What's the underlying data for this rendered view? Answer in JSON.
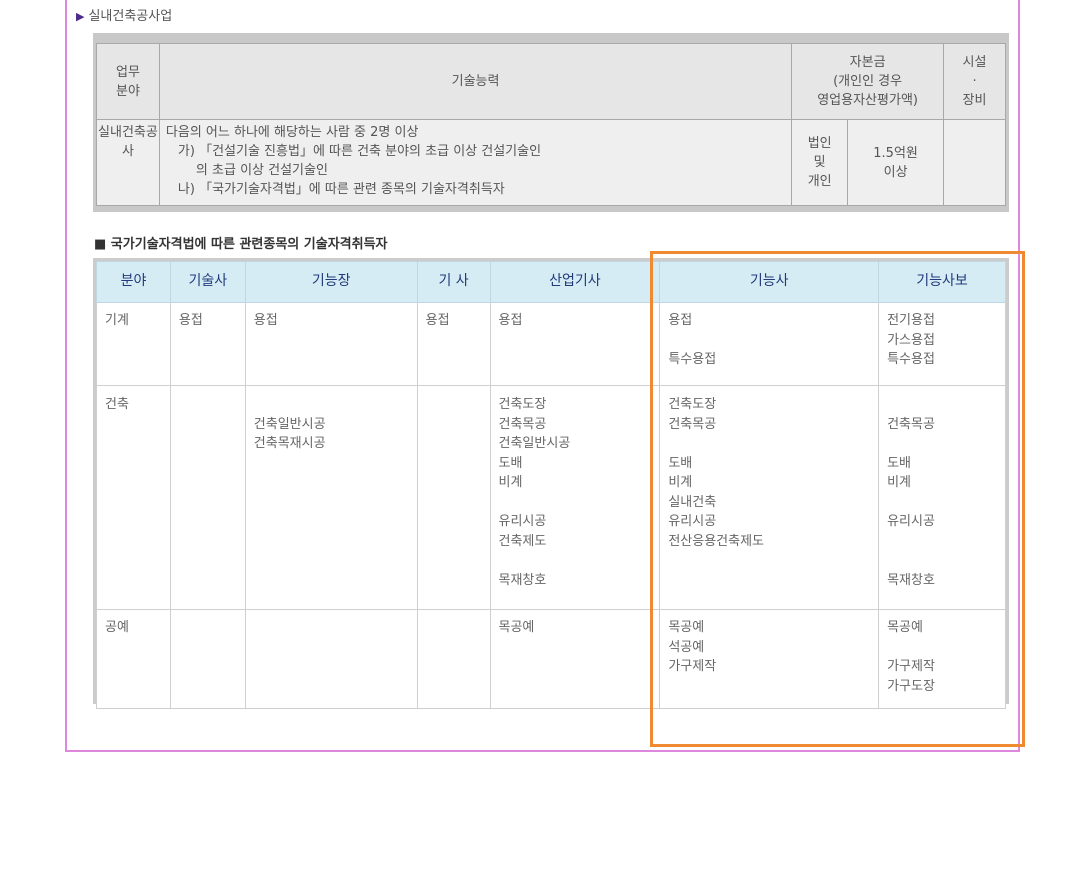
{
  "section_title": "실내건축공사업",
  "table1": {
    "headers": {
      "field": [
        "업무",
        "분야"
      ],
      "tech": "기술능력",
      "capital": [
        "자본금",
        "(개인인 경우",
        "영업용자산평가액)"
      ],
      "equipment": [
        "시설",
        "·",
        "장비"
      ]
    },
    "row": {
      "field": [
        "실내건축공",
        "사"
      ],
      "tech_lines": [
        "다음의 어느 하나에 해당하는 사람 중 2명 이상",
        "가) 「건설기술 진흥법」에 따른 건축 분야의 초급 이상 건설기술인",
        "의 초급 이상 건설기술인",
        "나) 「국가기술자격법」에 따른 관련 종목의 기술자격취득자"
      ],
      "entity": [
        "법인",
        "및",
        "개인"
      ],
      "capital": [
        "1.5억원",
        "이상"
      ],
      "equipment": ""
    }
  },
  "table2": {
    "title": "■ 국가기술자격법에 따른 관련종목의 기술자격취득자",
    "headers": [
      "분야",
      "기술사",
      "기능장",
      "기 사",
      "산업기사",
      "기능사",
      "기능사보"
    ],
    "rows": [
      {
        "field": "기계",
        "c1": [
          "용접"
        ],
        "c2": [
          "용접"
        ],
        "c3": [
          "용접"
        ],
        "c4": [
          "용접"
        ],
        "c5": [
          "용접",
          "",
          "특수용접"
        ],
        "c6": [
          "전기용접",
          "가스용접",
          "특수용접"
        ]
      },
      {
        "field": "건축",
        "c1": [],
        "c2": [
          "",
          "건축일반시공",
          "건축목재시공"
        ],
        "c3": [],
        "c4": [
          "건축도장",
          "건축목공",
          "건축일반시공",
          "도배",
          "비계",
          "",
          "유리시공",
          "건축제도",
          "",
          "목재창호"
        ],
        "c5": [
          "건축도장",
          "건축목공",
          "",
          "도배",
          "비계",
          "실내건축",
          "유리시공",
          "전산응용건축제도"
        ],
        "c6": [
          "",
          "건축목공",
          "",
          "도배",
          "비계",
          "",
          "유리시공",
          "",
          "",
          "목재창호"
        ]
      },
      {
        "field": "공예",
        "c1": [],
        "c2": [],
        "c3": [],
        "c4": [
          "목공예"
        ],
        "c5": [
          "목공예",
          "석공예",
          "가구제작"
        ],
        "c6": [
          "목공예",
          "",
          "가구제작",
          "가구도장"
        ]
      }
    ]
  }
}
